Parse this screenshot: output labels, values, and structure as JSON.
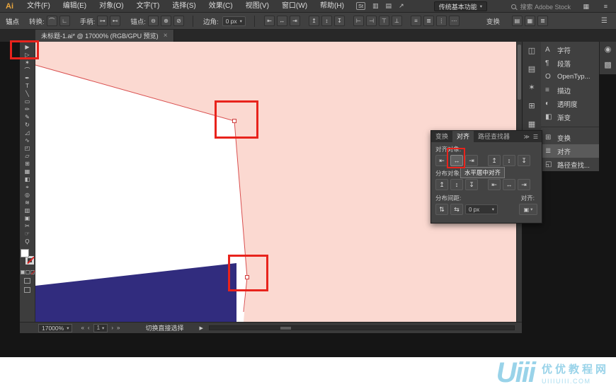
{
  "app": {
    "logo": "Ai"
  },
  "menu_bar": {
    "items": [
      "文件(F)",
      "编辑(E)",
      "对象(O)",
      "文字(T)",
      "选择(S)",
      "效果(C)",
      "视图(V)",
      "窗口(W)",
      "帮助(H)"
    ],
    "stock_badge": "St",
    "app_icons": [
      "▥",
      "▤",
      "↗"
    ],
    "workspace_button": "传统基本功能",
    "search_placeholder": "搜索 Adobe Stock",
    "right_icon_1": "▦",
    "right_icon_2": "≡"
  },
  "control_bar": {
    "panel_label": "锚点",
    "convert": {
      "label": "转换:",
      "icons": [
        "⌒",
        "∟"
      ]
    },
    "handles": {
      "label": "手柄:",
      "icons": [
        "⊶",
        "⊷"
      ]
    },
    "anchors": {
      "label": "锚点:",
      "icons": [
        "⊖",
        "⊕",
        "⊘"
      ]
    },
    "corner": {
      "label": "边角:",
      "value": "0 px"
    },
    "align_icons": [
      "⇤",
      "↔",
      "⇥",
      "↥",
      "↕",
      "↧",
      "⊢",
      "⊣",
      "⊤",
      "⊥",
      "≡",
      "≣",
      "⋮",
      "⋯"
    ],
    "transform_label": "变换",
    "right_icons": [
      "▤",
      "▦",
      "≣"
    ],
    "menu_icon": "☰"
  },
  "document_tab": {
    "title": "未标题-1.ai* @ 17000% (RGB/GPU 预览)",
    "close": "×"
  },
  "toolbar": {
    "tools": [
      {
        "name": "selection-tool",
        "glyph": "▶"
      },
      {
        "name": "direct-selection-tool",
        "glyph": "▷"
      },
      {
        "name": "magic-wand-tool",
        "glyph": "✶"
      },
      {
        "name": "lasso-tool",
        "glyph": "⌒"
      },
      {
        "name": "pen-tool",
        "glyph": "✒"
      },
      {
        "name": "type-tool",
        "glyph": "T"
      },
      {
        "name": "line-segment-tool",
        "glyph": "╲"
      },
      {
        "name": "rectangle-tool",
        "glyph": "▭"
      },
      {
        "name": "paintbrush-tool",
        "glyph": "✏"
      },
      {
        "name": "pencil-tool",
        "glyph": "✎"
      },
      {
        "name": "rotate-tool",
        "glyph": "↻"
      },
      {
        "name": "scale-tool",
        "glyph": "◿"
      },
      {
        "name": "width-tool",
        "glyph": "∿"
      },
      {
        "name": "free-transform-tool",
        "glyph": "◰"
      },
      {
        "name": "shape-builder-tool",
        "glyph": "▱"
      },
      {
        "name": "perspective-grid-tool",
        "glyph": "⊞"
      },
      {
        "name": "mesh-tool",
        "glyph": "▦"
      },
      {
        "name": "gradient-tool",
        "glyph": "◧"
      },
      {
        "name": "eyedropper-tool",
        "glyph": "⌖"
      },
      {
        "name": "blend-tool",
        "glyph": "◎"
      },
      {
        "name": "symbol-sprayer-tool",
        "glyph": "≋"
      },
      {
        "name": "column-graph-tool",
        "glyph": "▥"
      },
      {
        "name": "artboard-tool",
        "glyph": "▣"
      },
      {
        "name": "slice-tool",
        "glyph": "✂"
      },
      {
        "name": "hand-tool",
        "glyph": "☞"
      },
      {
        "name": "zoom-tool",
        "glyph": "Ϙ"
      }
    ]
  },
  "canvas": {
    "artboard_color": "#fbd9d1",
    "shape_white": "#ffffff",
    "shape_navy": "#312c7e",
    "path_color": "#d94f4f"
  },
  "align_panel": {
    "tabs": [
      "变换",
      "对齐",
      "路径查找器"
    ],
    "header_icon_collapse": "≫",
    "header_icon_menu": "☰",
    "align_objects_label": "对齐对象:",
    "align_objects_icons": [
      "⇤",
      "↔",
      "⇥",
      "↥",
      "↕",
      "↧"
    ],
    "tooltip": "水平居中对齐",
    "distribute_label": "分布对象:",
    "distribute_icons": [
      "↥",
      "↕",
      "↧",
      "⇤",
      "↔",
      "⇥"
    ],
    "spacing_label": "分布间距:",
    "spacing_icons": [
      "⇅",
      "⇆"
    ],
    "spacing_value": "0 px",
    "align_to_label": "对齐:",
    "align_to_icon": "▣"
  },
  "right_dock": {
    "strip_icons": [
      "◫",
      "▤",
      "✶",
      "⊞",
      "▦",
      "◨",
      "▥",
      "◭",
      "▧"
    ],
    "panels": [
      {
        "icon": "A",
        "label": "字符"
      },
      {
        "icon": "¶",
        "label": "段落"
      },
      {
        "icon": "O",
        "label": "OpenTyp..."
      },
      {
        "icon": "≡",
        "label": "描边"
      },
      {
        "icon": "◐",
        "label": "透明度"
      },
      {
        "icon": "◧",
        "label": "渐变"
      }
    ],
    "panels2": [
      {
        "icon": "⊞",
        "label": "变换"
      },
      {
        "icon": "≣",
        "label": "对齐"
      },
      {
        "icon": "◱",
        "label": "路径查找..."
      }
    ],
    "far_icons": [
      "◉",
      "▩"
    ]
  },
  "status_bar": {
    "zoom": "17000%",
    "nav_icons": [
      "«",
      "‹",
      "›",
      "»"
    ],
    "artboard_number": "1",
    "hint": "切换直接选择",
    "play_icon": "▶"
  },
  "watermark": {
    "logo": "Uiii",
    "site_name": "优优教程网",
    "site_url": "UIIIUIII.COM"
  }
}
